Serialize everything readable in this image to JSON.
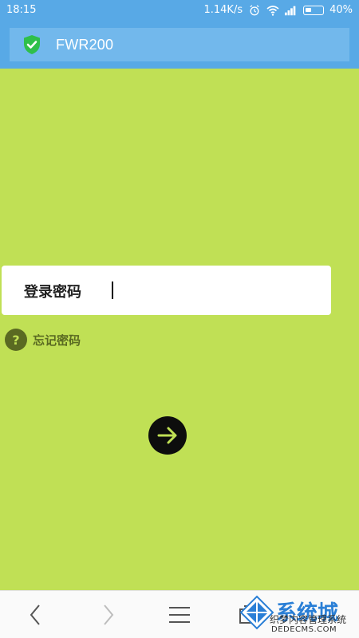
{
  "status_bar": {
    "time": "18:15",
    "speed": "1.14K/s",
    "battery": "40%",
    "icons": [
      "alarm-icon",
      "wifi-icon",
      "signal-icon",
      "battery-icon"
    ]
  },
  "browser": {
    "title": "FWR200",
    "security_icon": "shield-check-icon"
  },
  "login": {
    "password_label": "登录密码",
    "password_value": "",
    "forgot_label": "忘记密码",
    "go_icon": "arrow-right-icon"
  },
  "bottom_nav": {
    "items": [
      "back-icon",
      "forward-icon",
      "menu-icon",
      "tabs-icon"
    ]
  },
  "watermark": {
    "brand": "系统城",
    "line1": "织梦内容管理系统",
    "line2": "DEDECMS.COM"
  },
  "colors": {
    "background": "#c0e055",
    "header": "#58a9e6",
    "accent_dark": "#5a6a22",
    "shield": "#2fbf4a"
  }
}
